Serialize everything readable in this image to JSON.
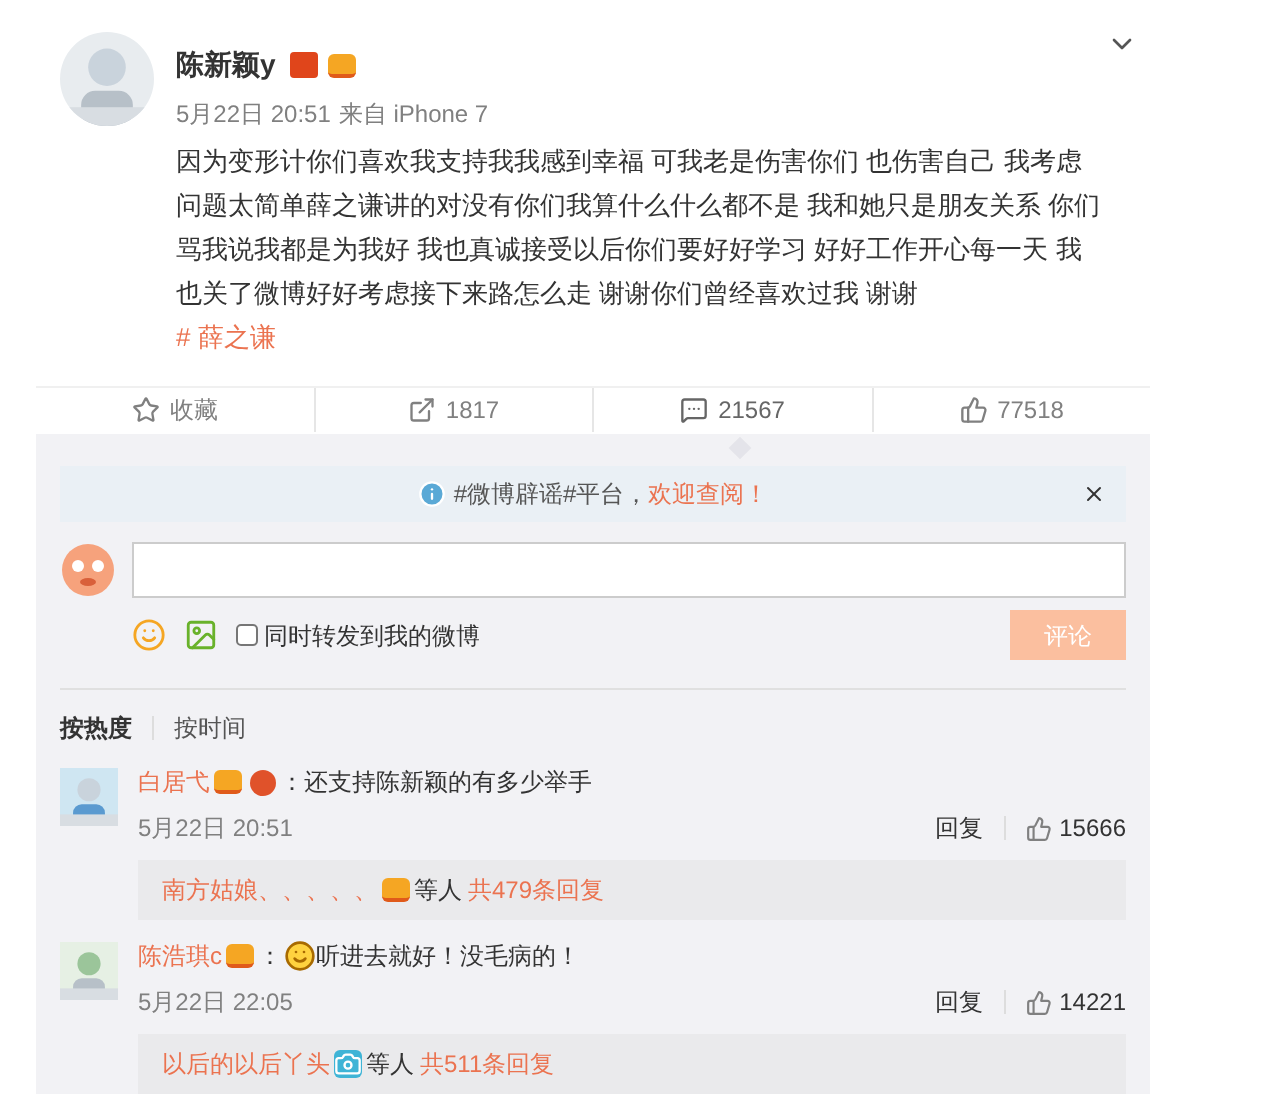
{
  "post": {
    "author": "陈新颖y",
    "verified": true,
    "vip": true,
    "time": "5月22日 20:51",
    "source": "来自 iPhone 7",
    "text": "因为变形计你们喜欢我支持我我感到幸福 可我老是伤害你们 也伤害自己 我考虑问题太简单薛之谦讲的对没有你们我算什么什么都不是 我和她只是朋友关系 你们骂我说我都是为我好 我也真诚接受以后你们要好好学习 好好工作开心每一天 我也关了微博好好考虑接下来路怎么走 谢谢你们曾经喜欢过我 谢谢",
    "topic": "# 薛之谦"
  },
  "actions": [
    {
      "kind": "favorite",
      "label": "收藏",
      "selected": false
    },
    {
      "kind": "repost",
      "label": "1817",
      "selected": false
    },
    {
      "kind": "comment",
      "label": "21567",
      "selected": true
    },
    {
      "kind": "like",
      "label": "77518",
      "selected": false
    }
  ],
  "notice": {
    "text": "#微博辟谣#平台，",
    "link": "欢迎查阅！"
  },
  "composer": {
    "repost_label": "同时转发到我的微博",
    "repost_checked": false,
    "submit": "评论"
  },
  "sort_tabs": [
    {
      "label": "按热度",
      "selected": true
    },
    {
      "label": "按时间",
      "selected": false
    }
  ],
  "comments": [
    {
      "author": "白居弋",
      "badges": [
        {
          "kind": "vip"
        },
        {
          "kind": "level"
        }
      ],
      "emoji": false,
      "text": "：还支持陈新颖的有多少举手",
      "time": "5月22日 20:51",
      "reply": "回复",
      "likes": "15666",
      "sub": {
        "author": "南方姑娘、、、、、",
        "badge": {
          "kind": "vip"
        },
        "mid": "等人",
        "count": "共479条回复"
      }
    },
    {
      "author": "陈浩琪c",
      "badges": [
        {
          "kind": "vip"
        }
      ],
      "emoji": true,
      "lead": "：",
      "text": "听进去就好！没毛病的！",
      "time": "5月22日 22:05",
      "reply": "回复",
      "likes": "14221",
      "sub": {
        "author": "以后的以后丫头",
        "badge": {
          "kind": "camera"
        },
        "mid": "等人",
        "count": "共511条回复"
      }
    }
  ]
}
